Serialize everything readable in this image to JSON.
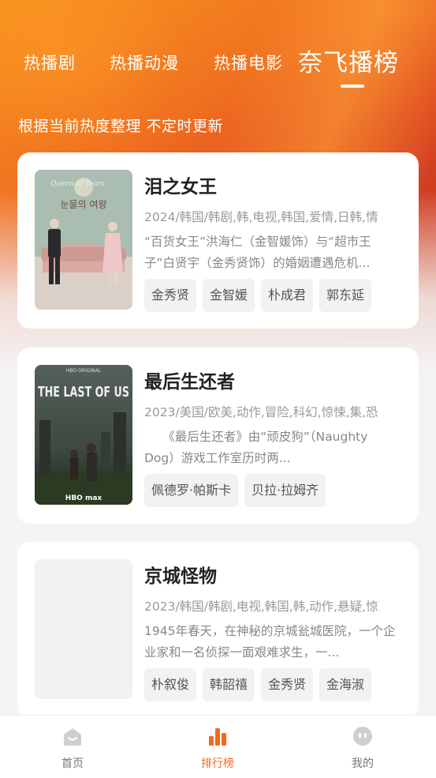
{
  "tabs": [
    {
      "label": "热播剧"
    },
    {
      "label": "热播动漫"
    },
    {
      "label": "热播电影"
    },
    {
      "label": "奈飞播榜",
      "active": true
    }
  ],
  "subtitle": "根据当前热度整理 不定时更新",
  "cards": [
    {
      "title": "泪之女王",
      "meta": "2024/韩国/韩剧,韩,电视,韩国,爱情,日韩,情",
      "desc": "“百货女王”洪海仁（金智媛饰）与“超市王子”白贤宇（金秀贤饰）的婚姻遭遇危机...",
      "tags": [
        "金秀贤",
        "金智媛",
        "朴成君",
        "郭东延"
      ],
      "poster": {
        "title_text": "눈물의 여왕",
        "logo_text": "Queen of Tears"
      }
    },
    {
      "title": "最后生还者",
      "meta": "2023/美国/欧美,动作,冒险,科幻,惊悚,集,恐",
      "desc": "　　《最后生还者》由“顽皮狗”（Naughty Dog）游戏工作室历时两...",
      "tags": [
        "佩德罗·帕斯卡",
        "贝拉·拉姆齐"
      ],
      "poster": {
        "brand_top": "HBO ORIGINAL",
        "title_text": "THE LAST OF US",
        "brand_bottom": "HBO max"
      }
    },
    {
      "title": "京城怪物",
      "meta": "2023/韩国/韩剧,电视,韩国,韩,动作,悬疑,惊",
      "desc": "1945年春天，在神秘的京城瓮城医院，一个企业家和一名侦探一面艰难求生，一...",
      "tags": [
        "朴叙俊",
        "韩韶禧",
        "金秀贤",
        "金海淑"
      ],
      "poster": {}
    }
  ],
  "nav": [
    {
      "label": "首页",
      "icon": "home-icon"
    },
    {
      "label": "排行榜",
      "icon": "ranking-icon",
      "active": true
    },
    {
      "label": "我的",
      "icon": "profile-icon"
    }
  ],
  "colors": {
    "accent": "#f06a1a",
    "hero_orange": "#f07020",
    "hero_red": "#d03e22"
  }
}
